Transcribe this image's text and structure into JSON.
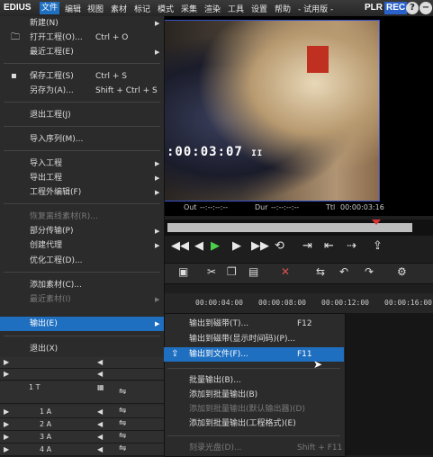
{
  "app": {
    "name": "EDIUS",
    "plr": "PLR",
    "rec": "REC",
    "colors": {
      "accent": "#1f6fc1",
      "rec_bg": "#2a62c9"
    }
  },
  "menubar": [
    "文件",
    "编辑",
    "视图",
    "素材",
    "标记",
    "模式",
    "采集",
    "渲染",
    "工具",
    "设置",
    "帮助",
    "- 试用版 -"
  ],
  "window_buttons": [
    "?",
    "−",
    "×"
  ],
  "file_menu": {
    "items": [
      {
        "label": "新建(N)",
        "shortcut": "",
        "arrow": "▶",
        "icon": ""
      },
      {
        "label": "打开工程(O)...",
        "shortcut": "Ctrl + O",
        "arrow": "",
        "icon": "folder-icon"
      },
      {
        "label": "最近工程(E)",
        "shortcut": "",
        "arrow": "▶",
        "icon": ""
      },
      {
        "label": "保存工程(S)",
        "shortcut": "Ctrl + S",
        "arrow": "",
        "icon": "save-icon"
      },
      {
        "label": "另存为(A)...",
        "shortcut": "Shift + Ctrl + S",
        "arrow": "",
        "icon": ""
      },
      {
        "label": "退出工程(J)",
        "shortcut": "",
        "arrow": "",
        "icon": ""
      },
      {
        "label": "导入序列(M)...",
        "shortcut": "",
        "arrow": "",
        "icon": ""
      },
      {
        "label": "导入工程",
        "shortcut": "",
        "arrow": "▶",
        "icon": ""
      },
      {
        "label": "导出工程",
        "shortcut": "",
        "arrow": "▶",
        "icon": ""
      },
      {
        "label": "工程外编辑(F)",
        "shortcut": "",
        "arrow": "▶",
        "icon": ""
      },
      {
        "label": "恢复离线素材(R)...",
        "shortcut": "",
        "arrow": "",
        "icon": ""
      },
      {
        "label": "部分传输(P)",
        "shortcut": "",
        "arrow": "▶",
        "icon": ""
      },
      {
        "label": "创建代理",
        "shortcut": "",
        "arrow": "▶",
        "icon": ""
      },
      {
        "label": "优化工程(D)...",
        "shortcut": "",
        "arrow": "",
        "icon": ""
      },
      {
        "label": "添加素材(C)...",
        "shortcut": "",
        "arrow": "",
        "icon": ""
      },
      {
        "label": "最近素材(I)",
        "shortcut": "",
        "arrow": "▶",
        "icon": ""
      },
      {
        "label": "输出(E)",
        "shortcut": "",
        "arrow": "▶",
        "icon": ""
      },
      {
        "label": "退出(X)",
        "shortcut": "",
        "arrow": "",
        "icon": ""
      }
    ]
  },
  "output_submenu": {
    "items": [
      {
        "label": "输出到磁带(T)...",
        "shortcut": "F12"
      },
      {
        "label": "输出到磁带(显示时间码)(P)...",
        "shortcut": ""
      },
      {
        "label": "输出到文件(F)...",
        "shortcut": "F11"
      },
      {
        "label": "批量输出(B)...",
        "shortcut": ""
      },
      {
        "label": "添加到批量输出(B)",
        "shortcut": ""
      },
      {
        "label": "添加到批量输出(默认输出器)(D)",
        "shortcut": ""
      },
      {
        "label": "添加到批量输出(工程格式)(E)",
        "shortcut": ""
      },
      {
        "label": "刻录光盘(D)...",
        "shortcut": "Shift + F11"
      }
    ]
  },
  "preview": {
    "timecode": ":00:03:07",
    "pause_mark": "II",
    "out_label": "Out",
    "out_value": "--:--:--:--",
    "dur_label": "Dur",
    "dur_value": "--:--:--:--",
    "ttl_label": "Ttl",
    "ttl_value": "00:00:03:16",
    "scrub_position": 0.85
  },
  "ruler": {
    "labels": [
      "00:00:04:00",
      "00:00:08:00",
      "00:00:12:00",
      "00:00:16:00"
    ]
  },
  "tracks": [
    {
      "name": "",
      "type": "arrow"
    },
    {
      "name": "",
      "type": "arrow"
    },
    {
      "name": "1 T",
      "type": "title"
    },
    {
      "name": "1 A",
      "type": "audio"
    },
    {
      "name": "2 A",
      "type": "audio"
    },
    {
      "name": "3 A",
      "type": "audio"
    },
    {
      "name": "4 A",
      "type": "audio"
    }
  ]
}
